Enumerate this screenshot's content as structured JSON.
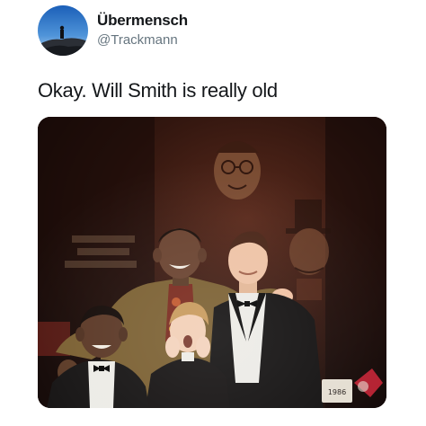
{
  "user": {
    "display_name": "Übermensch",
    "handle": "@Trackmann",
    "avatar_icon": "mountain-summit-avatar"
  },
  "tweet": {
    "text": "Okay. Will Smith is really old"
  },
  "media": {
    "kind": "photo",
    "sign_text": "1986"
  },
  "colors": {
    "text_primary": "#14171a",
    "text_secondary": "#66757f",
    "background": "#ffffff"
  }
}
